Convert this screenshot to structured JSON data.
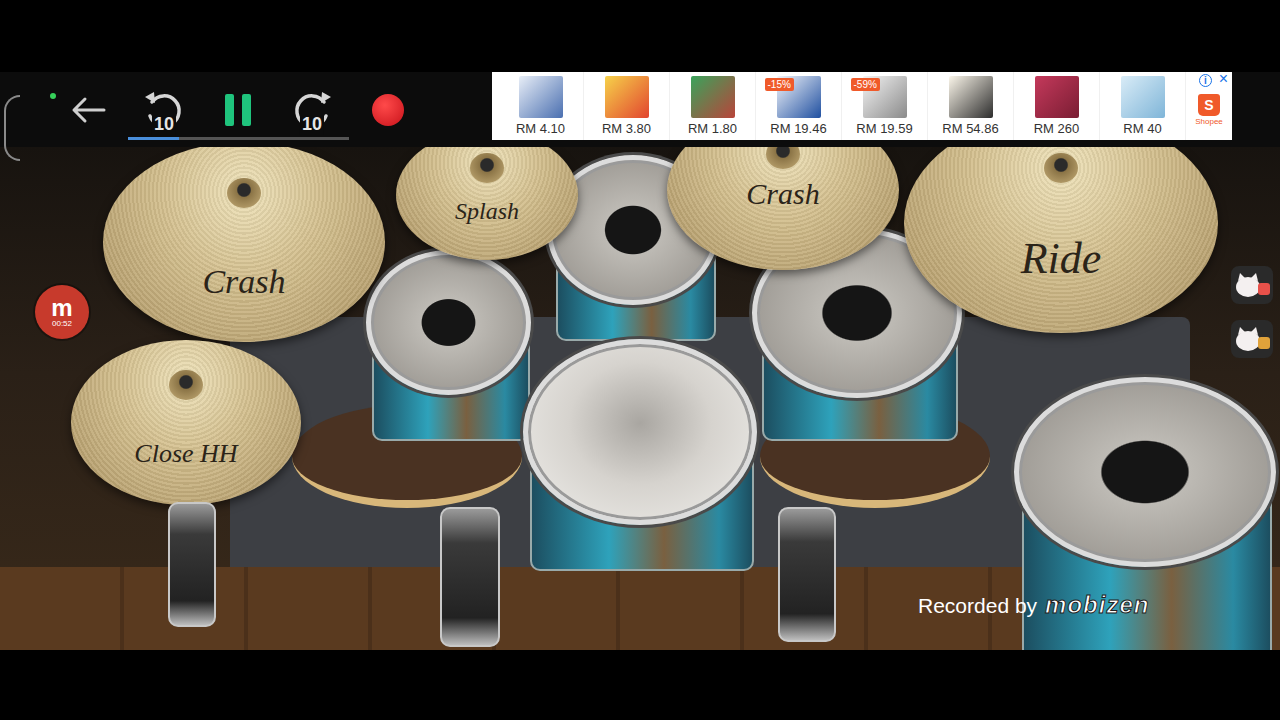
{
  "toolbar": {
    "rewind_label": "10",
    "forward_label": "10",
    "playing": true,
    "progress": {
      "level": 0.23
    }
  },
  "ad_banner": {
    "info_glyph": "i",
    "close_glyph": "×",
    "items": [
      {
        "price": "RM 4.10"
      },
      {
        "price": "RM 3.80"
      },
      {
        "price": "RM 1.80"
      },
      {
        "price": "RM 19.46",
        "badge": "-15%"
      },
      {
        "price": "RM 19.59",
        "badge": "-59%"
      },
      {
        "price": "RM 54.86"
      },
      {
        "price": "RM 260"
      },
      {
        "price": "RM 40"
      }
    ],
    "store": {
      "logo": "S",
      "name": "Shopee"
    }
  },
  "cymbals": [
    {
      "label": "Crash"
    },
    {
      "label": "Splash"
    },
    {
      "label": "Crash"
    },
    {
      "label": "Ride"
    },
    {
      "label": "Close HH"
    }
  ],
  "recorder_bubble": {
    "logo": "m",
    "time": "00:52"
  },
  "watermark": {
    "prefix": "Recorded by",
    "brand": "mobizen"
  }
}
